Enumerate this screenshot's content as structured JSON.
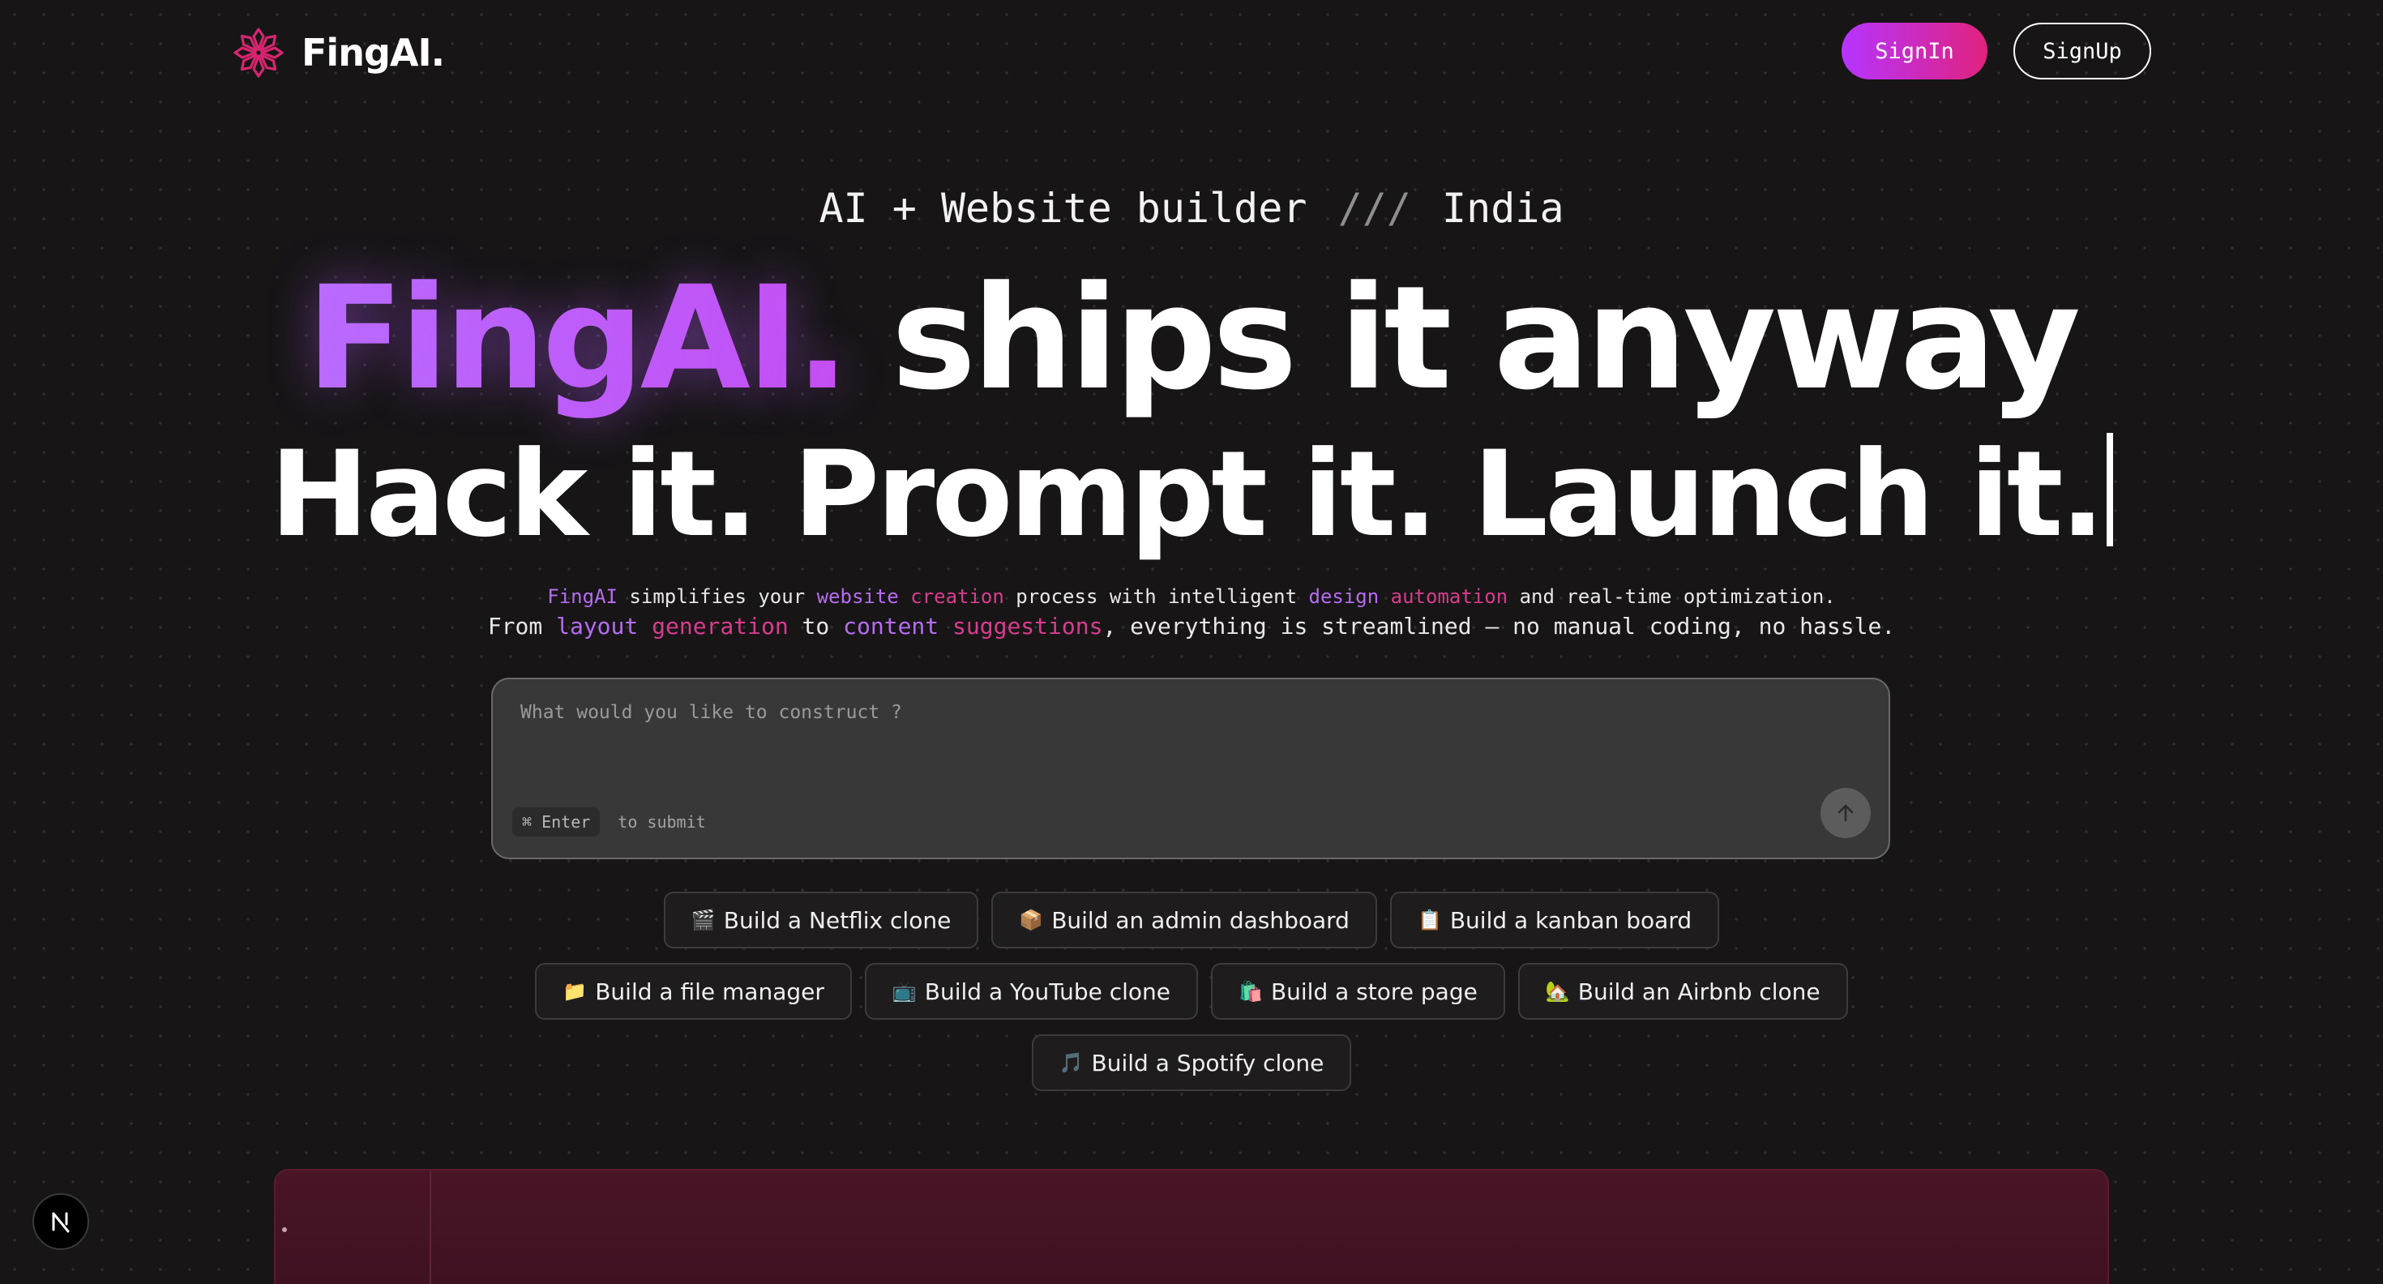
{
  "header": {
    "logo_text": "FingAI.",
    "logo_icon": "asterisk-flower-icon",
    "signin_label": "SignIn",
    "signup_label": "SignUp"
  },
  "hero": {
    "tagline_left": "AI + Website builder",
    "tagline_slashes": "///",
    "tagline_right": "India",
    "headline_brand": "FingAI.",
    "headline_rest": "ships it anyway",
    "subheadline": "Hack it. Prompt it. Launch it."
  },
  "description": {
    "line1": {
      "w1": "FingAI",
      "t1": " simplifies your ",
      "w2": "website",
      "w3": "creation",
      "t2": " process with intelligent ",
      "w4": "design",
      "w5": "automation",
      "t3": " and real-time optimization."
    },
    "line2": {
      "t1": "From ",
      "w1": "layout",
      "w2": "generation",
      "t2": " to ",
      "w3": "content",
      "w4": "suggestions",
      "t3": ", everything is streamlined — no manual coding, no hassle."
    }
  },
  "prompt": {
    "placeholder": "What would you like to construct ?",
    "value": "",
    "shortcut_key": "⌘ Enter",
    "shortcut_hint": "to submit",
    "submit_icon": "arrow-up-icon"
  },
  "suggestions": {
    "row1": [
      {
        "emoji": "🎬",
        "label": "Build a Netflix clone"
      },
      {
        "emoji": "📦",
        "label": "Build an admin dashboard"
      },
      {
        "emoji": "📋",
        "label": "Build a kanban board"
      }
    ],
    "row2": [
      {
        "emoji": "📁",
        "label": "Build a file manager"
      },
      {
        "emoji": "📺",
        "label": "Build a YouTube clone"
      },
      {
        "emoji": "🛍️",
        "label": "Build a store page"
      },
      {
        "emoji": "🏡",
        "label": "Build an Airbnb clone"
      }
    ],
    "row3": [
      {
        "emoji": "🎵",
        "label": "Build a Spotify clone"
      }
    ]
  },
  "badge": {
    "letter": "N",
    "icon": "nextjs-logo-icon"
  },
  "colors": {
    "background": "#171516",
    "accent_purple": "#b66cf2",
    "accent_pink": "#d83c8e",
    "signin_gradient_start": "#b634ff",
    "signin_gradient_end": "#e1227d",
    "logo_pink": "#d8256f",
    "preview_panel": "#4a1526"
  }
}
